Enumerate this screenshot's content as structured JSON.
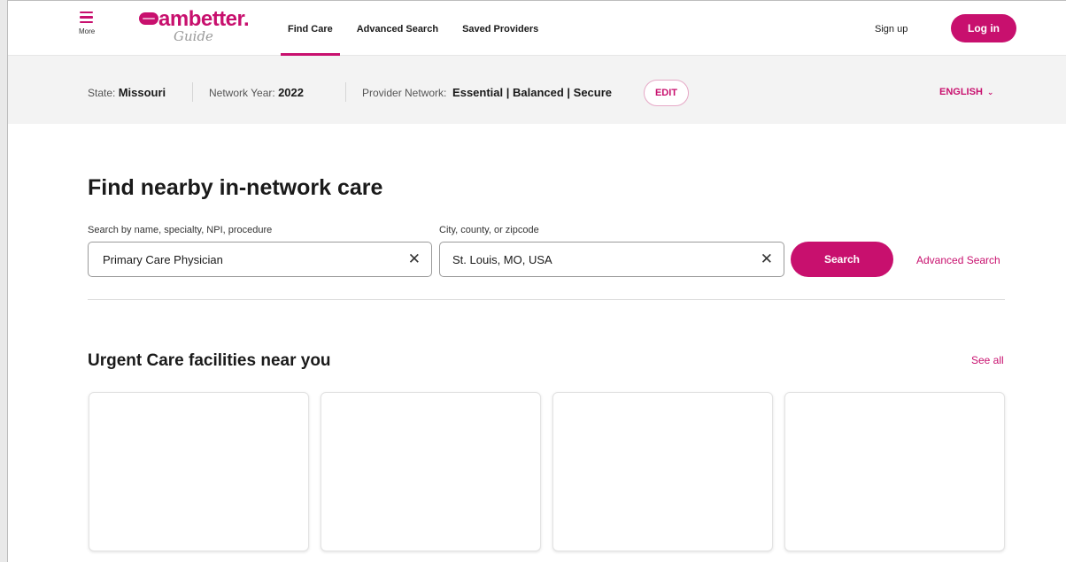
{
  "header": {
    "menu_label": "More",
    "logo_word": "ambetter.",
    "logo_sub": "Guide",
    "nav": [
      {
        "label": "Find Care"
      },
      {
        "label": "Advanced Search"
      },
      {
        "label": "Saved Providers"
      }
    ],
    "signup_label": "Sign up",
    "login_label": "Log in"
  },
  "infobar": {
    "state_label": "State:",
    "state_value": "Missouri",
    "year_label": "Network Year:",
    "year_value": "2022",
    "network_label": "Provider Network:",
    "network_value": "Essential | Balanced | Secure",
    "edit_label": "EDIT",
    "language_label": "ENGLISH"
  },
  "main": {
    "title": "Find nearby in-network care",
    "search_label": "Search by name, specialty, NPI, procedure",
    "search_value": "Primary Care Physician",
    "location_label": "City, county, or zipcode",
    "location_value": "St. Louis, MO, USA",
    "search_button": "Search",
    "advanced_link": "Advanced Search"
  },
  "urgent": {
    "heading": "Urgent Care facilities near you",
    "see_all": "See all"
  },
  "colors": {
    "brand": "#c8106e",
    "bar_bg": "#f3f3f3"
  }
}
